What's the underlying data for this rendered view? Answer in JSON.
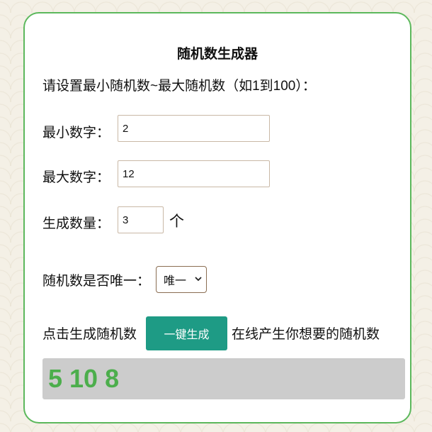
{
  "title": "随机数生成器",
  "instruction": "请设置最小随机数~最大随机数（如1到100）：",
  "min": {
    "label": "最小数字：",
    "value": "2"
  },
  "max": {
    "label": "最大数字：",
    "value": "12"
  },
  "count": {
    "label": "生成数量：",
    "value": "3",
    "unit": "个"
  },
  "unique": {
    "label": "随机数是否唯一：",
    "selected": "唯一"
  },
  "generate": {
    "prefix": "点击生成随机数",
    "button_label": "一键生成",
    "suffix": "在线产生你想要的随机数"
  },
  "result": "5 10 8",
  "colors": {
    "card_border": "#5cb85c",
    "button_bg": "#1e9b85",
    "result_text": "#4cae4c",
    "result_bg": "#cccccc"
  }
}
